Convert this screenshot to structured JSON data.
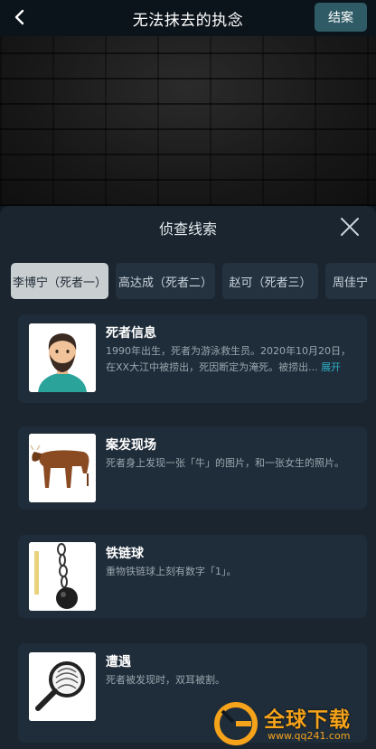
{
  "header": {
    "title": "无法抹去的执念",
    "action_label": "结案"
  },
  "panel": {
    "title": "侦查线索"
  },
  "tabs": [
    {
      "label": "李博宁（死者一）",
      "active": true
    },
    {
      "label": "高达成（死者二）",
      "active": false
    },
    {
      "label": "赵可（死者三）",
      "active": false
    },
    {
      "label": "周佳宁",
      "active": false
    }
  ],
  "clues": [
    {
      "title": "死者信息",
      "desc": "1990年出生，死者为游泳救生员。2020年10月20日，在XX大江中被捞出，死因断定为淹死。被捞出...",
      "expand": "展开",
      "icon": "man-avatar-icon"
    },
    {
      "title": "案发现场",
      "desc": "死者身上发现一张「牛」的图片，和一张女生的照片。",
      "icon": "cow-photo-icon"
    },
    {
      "title": "铁链球",
      "desc": "重物铁链球上刻有数字「1」。",
      "icon": "chain-ball-icon"
    },
    {
      "title": "遭遇",
      "desc": "死者被发现时，双耳被割。",
      "icon": "magnifier-fingerprint-icon"
    }
  ],
  "watermark": {
    "text": "全球下载",
    "url": "www.qq241.com"
  },
  "colors": {
    "accent": "#2fb0c6",
    "button": "#2f5b66",
    "panel": "#1a2530",
    "card": "#1f2d3a",
    "watermark": "#f5a31b"
  }
}
